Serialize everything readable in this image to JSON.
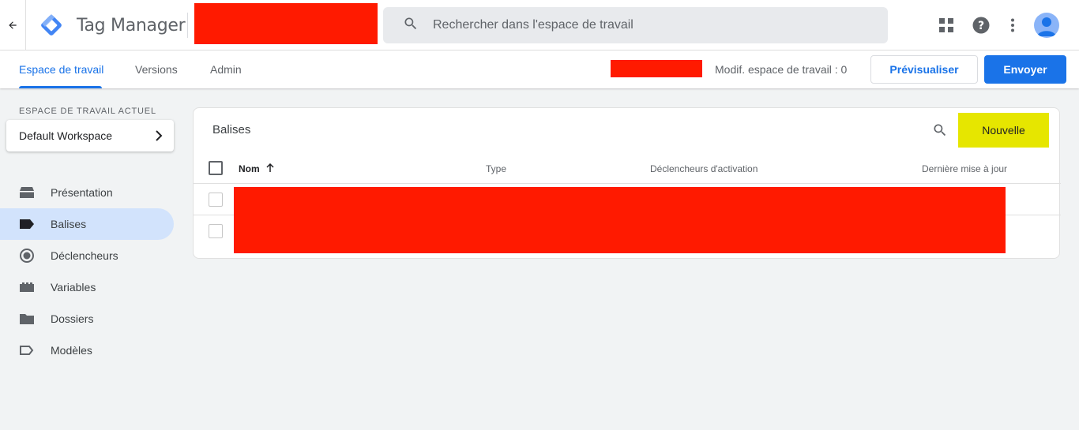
{
  "header": {
    "app_title": "Tag Manager",
    "search_placeholder": "Rechercher dans l'espace de travail",
    "icons": [
      "back-arrow-icon",
      "gtm-logo-icon",
      "search-icon",
      "apps-grid-icon",
      "help-icon",
      "more-vert-icon",
      "account-avatar-icon"
    ]
  },
  "toolbar": {
    "tabs": [
      {
        "label": "Espace de travail",
        "active": true
      },
      {
        "label": "Versions",
        "active": false
      },
      {
        "label": "Admin",
        "active": false
      }
    ],
    "workspace_changes": "Modif. espace de travail : 0",
    "preview_label": "Prévisualiser",
    "submit_label": "Envoyer"
  },
  "sidebar": {
    "current_workspace_label": "ESPACE DE TRAVAIL ACTUEL",
    "workspace_name": "Default Workspace",
    "items": [
      {
        "label": "Présentation",
        "icon": "overview-icon",
        "active": false
      },
      {
        "label": "Balises",
        "icon": "tag-icon",
        "active": true
      },
      {
        "label": "Déclencheurs",
        "icon": "trigger-icon",
        "active": false
      },
      {
        "label": "Variables",
        "icon": "variables-icon",
        "active": false
      },
      {
        "label": "Dossiers",
        "icon": "folder-icon",
        "active": false
      },
      {
        "label": "Modèles",
        "icon": "template-icon",
        "active": false
      }
    ]
  },
  "main": {
    "title": "Balises",
    "new_button": "Nouvelle",
    "columns": [
      "Nom",
      "Type",
      "Déclencheurs d'activation",
      "Dernière mise à jour"
    ],
    "row_count": 2
  },
  "colors": {
    "accent": "#1a73e8",
    "highlight": "#e6e600",
    "redaction": "#ff1a00",
    "active_nav_bg": "#d2e3fc"
  }
}
